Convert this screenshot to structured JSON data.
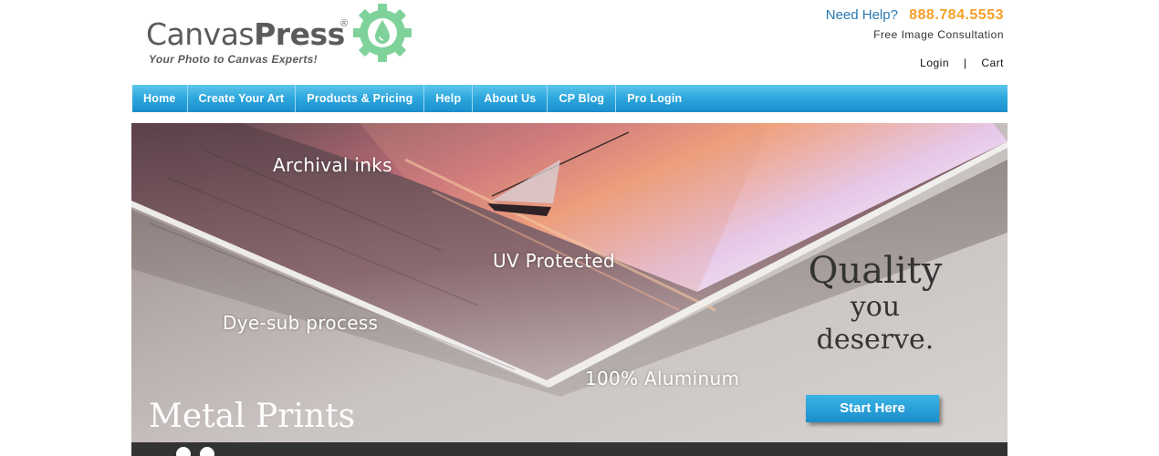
{
  "brand": {
    "name_light": "Canvas",
    "name_bold": "Press",
    "registered": "®",
    "tagline": "Your Photo to Canvas Experts!",
    "gear_color": "#7fd39a"
  },
  "help": {
    "label": "Need Help?",
    "phone": "888.784.5553",
    "subtitle": "Free Image Consultation"
  },
  "account": {
    "login": "Login",
    "separator": "|",
    "cart": "Cart"
  },
  "nav": {
    "items": [
      {
        "label": "Home"
      },
      {
        "label": "Create Your Art"
      },
      {
        "label": "Products & Pricing"
      },
      {
        "label": "Help"
      },
      {
        "label": "About Us"
      },
      {
        "label": "CP Blog"
      },
      {
        "label": "Pro Login"
      }
    ]
  },
  "hero": {
    "features": {
      "archival": "Archival inks",
      "uv": "UV Protected",
      "dye": "Dye-sub process",
      "aluminum": "100% Aluminum"
    },
    "quality_line1": "Quality",
    "quality_line2": "you",
    "quality_line3": "deserve.",
    "product_title": "Metal Prints",
    "cta_label": "Start Here"
  },
  "colors": {
    "nav_blue": "#2ca6dd",
    "phone_orange": "#f5a028",
    "help_blue": "#2a7ab0"
  }
}
